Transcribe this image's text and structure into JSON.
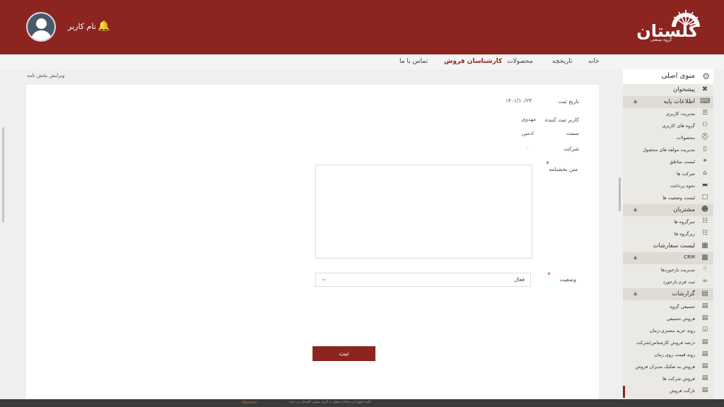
{
  "header": {
    "username": "نام کاربر",
    "logo_text": "گلستان",
    "logo_subtitle": "گروه صنعتی",
    "brand_color": "#8c2520"
  },
  "nav": {
    "items": [
      "خانه",
      "تاریخچه",
      "محصولات",
      "کارشناسان فروش",
      "تماس با ما"
    ],
    "active": "کارشناسان فروش"
  },
  "breadcrumb": "ویرایش بخش نامه",
  "form": {
    "date_label": "تاریخ ثبت",
    "date_value": "۱۴۰۱/۱۰/۲۳",
    "registrar_label": "کاربر ثبت کننده",
    "registrar_value": "مهدوی",
    "position_label": "سمت",
    "position_value": "ادمین",
    "company_label": "شرکت",
    "company_value": "۰",
    "text_label": "متن بخشنامه",
    "status_label": "وضعیت",
    "status_value": "فعال",
    "submit_label": "ثبت",
    "required_mark": "*"
  },
  "sidebar": {
    "main_menu": "منوی اصلی",
    "items": [
      {
        "label": "پیشخوان",
        "icon": "tools-icon",
        "level": "section"
      },
      {
        "label": "اطلاعات پایه",
        "icon": "keyboard-icon",
        "level": "header"
      },
      {
        "label": "مدیریت کاربری",
        "icon": "sliders-icon",
        "level": "sub"
      },
      {
        "label": "گروه های کاربری",
        "icon": "users-icon",
        "level": "sub"
      },
      {
        "label": "محصولات",
        "icon": "basket-icon",
        "level": "sub"
      },
      {
        "label": "مدیریت مولفه های محصول",
        "icon": "bookmark-icon",
        "level": "sub"
      },
      {
        "label": "لیست مناطق",
        "icon": "globe-icon",
        "level": "sub"
      },
      {
        "label": "شرکت ها",
        "icon": "building-icon",
        "level": "sub"
      },
      {
        "label": "نحوه پرداخت",
        "icon": "card-icon",
        "level": "sub"
      },
      {
        "label": "لیست وضعیت ها",
        "icon": "file-icon",
        "level": "sub"
      },
      {
        "label": "مشتریان",
        "icon": "customers-icon",
        "level": "header"
      },
      {
        "label": "سرگروه ها",
        "icon": "hierarchy-icon",
        "level": "sub"
      },
      {
        "label": "زیرگروه ها",
        "icon": "sitemap-icon",
        "level": "sub"
      },
      {
        "label": "لیست سفارشات",
        "icon": "clipboard-icon",
        "level": "section"
      },
      {
        "label": "CRM",
        "icon": "crm-icon",
        "level": "header"
      },
      {
        "label": "مدیریت بازخوردها",
        "icon": "thumbs-up-icon",
        "level": "sub"
      },
      {
        "label": "ثبت فرم بازخورد",
        "icon": "paperclip-icon",
        "level": "sub"
      },
      {
        "label": "گزارشات",
        "icon": "report-icon",
        "level": "header"
      },
      {
        "label": "تجمیعی گروه",
        "icon": "doc-icon",
        "level": "sub"
      },
      {
        "label": "فروش تجمیعی",
        "icon": "doc-icon",
        "level": "sub"
      },
      {
        "label": "روند خرید مشتری-زمان",
        "icon": "doc-check-icon",
        "level": "sub"
      },
      {
        "label": "درصد فروش کارشناس/شرکت",
        "icon": "doc-icon",
        "level": "sub"
      },
      {
        "label": "روند قیمت روی زمان",
        "icon": "doc-icon",
        "level": "sub"
      },
      {
        "label": "فروش به تفکیک مدیران فروش",
        "icon": "doc-icon",
        "level": "sub"
      },
      {
        "label": "فروش شرکت ها",
        "icon": "doc-icon",
        "level": "sub"
      },
      {
        "label": "تارگت فروش",
        "icon": "doc-icon",
        "level": "sub"
      }
    ]
  },
  "footer": {
    "brand": "Rayvarz",
    "note": "کلیه حقوق این سامانه متعلق به گروه صنعتی گلستان می باشد"
  }
}
